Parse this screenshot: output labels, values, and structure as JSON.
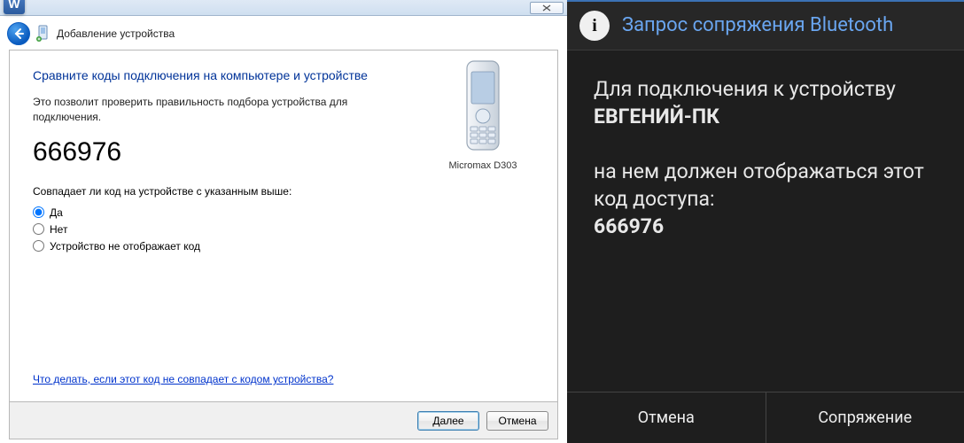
{
  "win": {
    "nav_title": "Добавление устройства",
    "heading": "Сравните коды подключения на компьютере и устройстве",
    "desc": "Это позволит проверить правильность подбора устройства для подключения.",
    "code": "666976",
    "question": "Совпадает ли код на устройстве с указанным выше:",
    "radio_yes": "Да",
    "radio_no": "Нет",
    "radio_nocode": "Устройство не отображает код",
    "device_caption": "Micromax D303",
    "help_link": "Что делать, если этот код не совпадает с кодом устройства?",
    "btn_next": "Далее",
    "btn_cancel": "Отмена"
  },
  "android": {
    "title": "Запрос сопряжения Bluetooth",
    "line1": "Для подключения к устройству",
    "device_name": "ЕВГЕНИЙ-ПК",
    "line2": "на нем должен отображаться этот код доступа:",
    "code": "666976",
    "btn_cancel": "Отмена",
    "btn_pair": "Сопряжение"
  }
}
